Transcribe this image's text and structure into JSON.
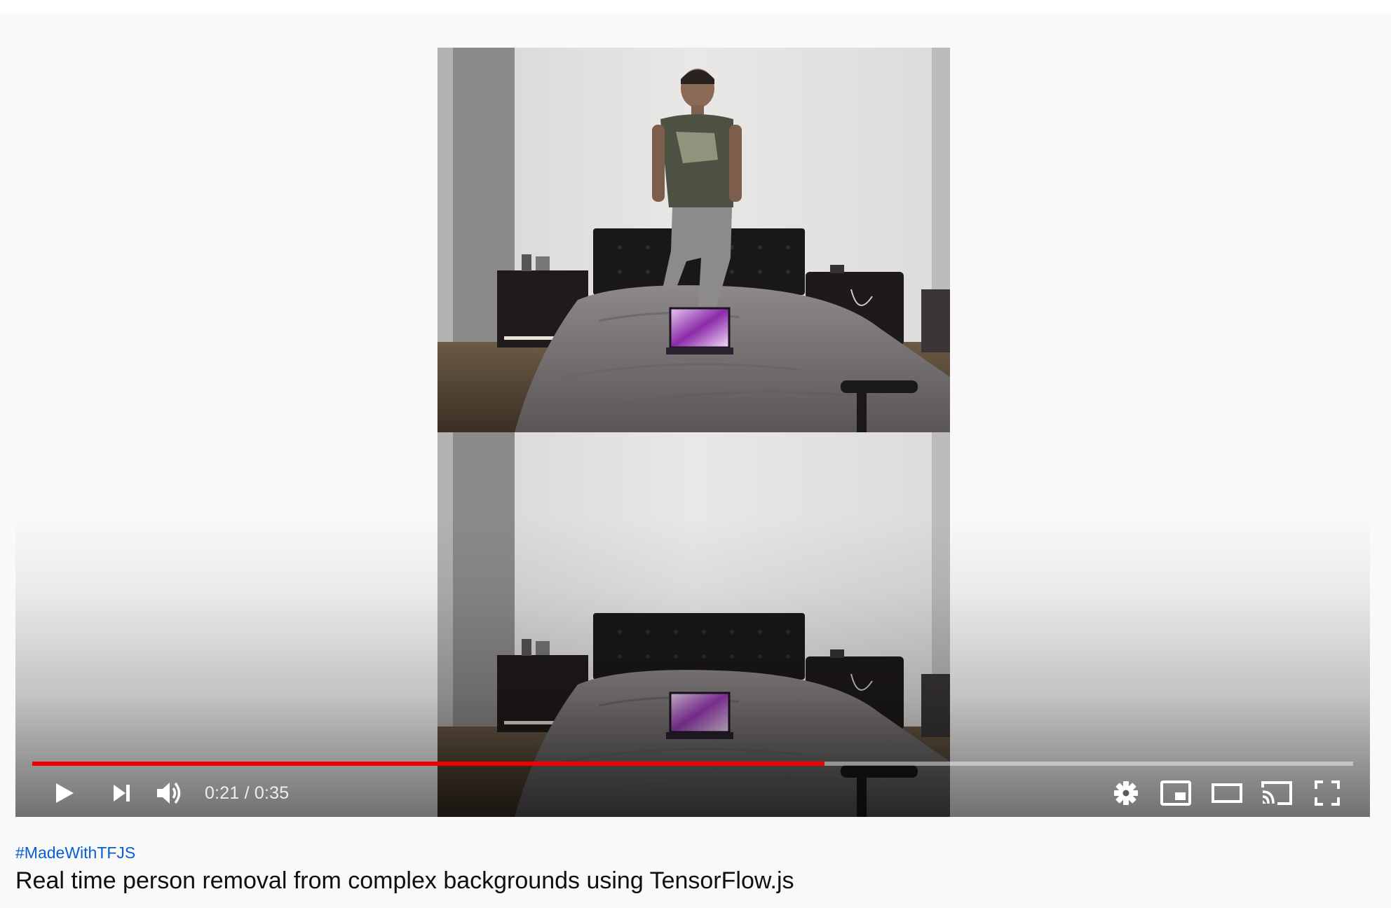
{
  "player": {
    "time_current": "0:21",
    "time_total": "0:35",
    "time_display": "0:21 / 0:35",
    "progress_fraction": 0.6,
    "progress_color": "#f00000"
  },
  "controls": {
    "play_icon": "play-icon",
    "next_icon": "next-icon",
    "volume_icon": "volume-icon",
    "settings_icon": "gear-icon",
    "miniplayer_icon": "miniplayer-icon",
    "theater_icon": "theater-mode-icon",
    "cast_icon": "cast-icon",
    "fullscreen_icon": "fullscreen-icon"
  },
  "video": {
    "hashtag": "#MadeWithTFJS",
    "title": "Real time person removal from complex backgrounds using TensorFlow.js",
    "hashtag_color": "#065fd4"
  }
}
